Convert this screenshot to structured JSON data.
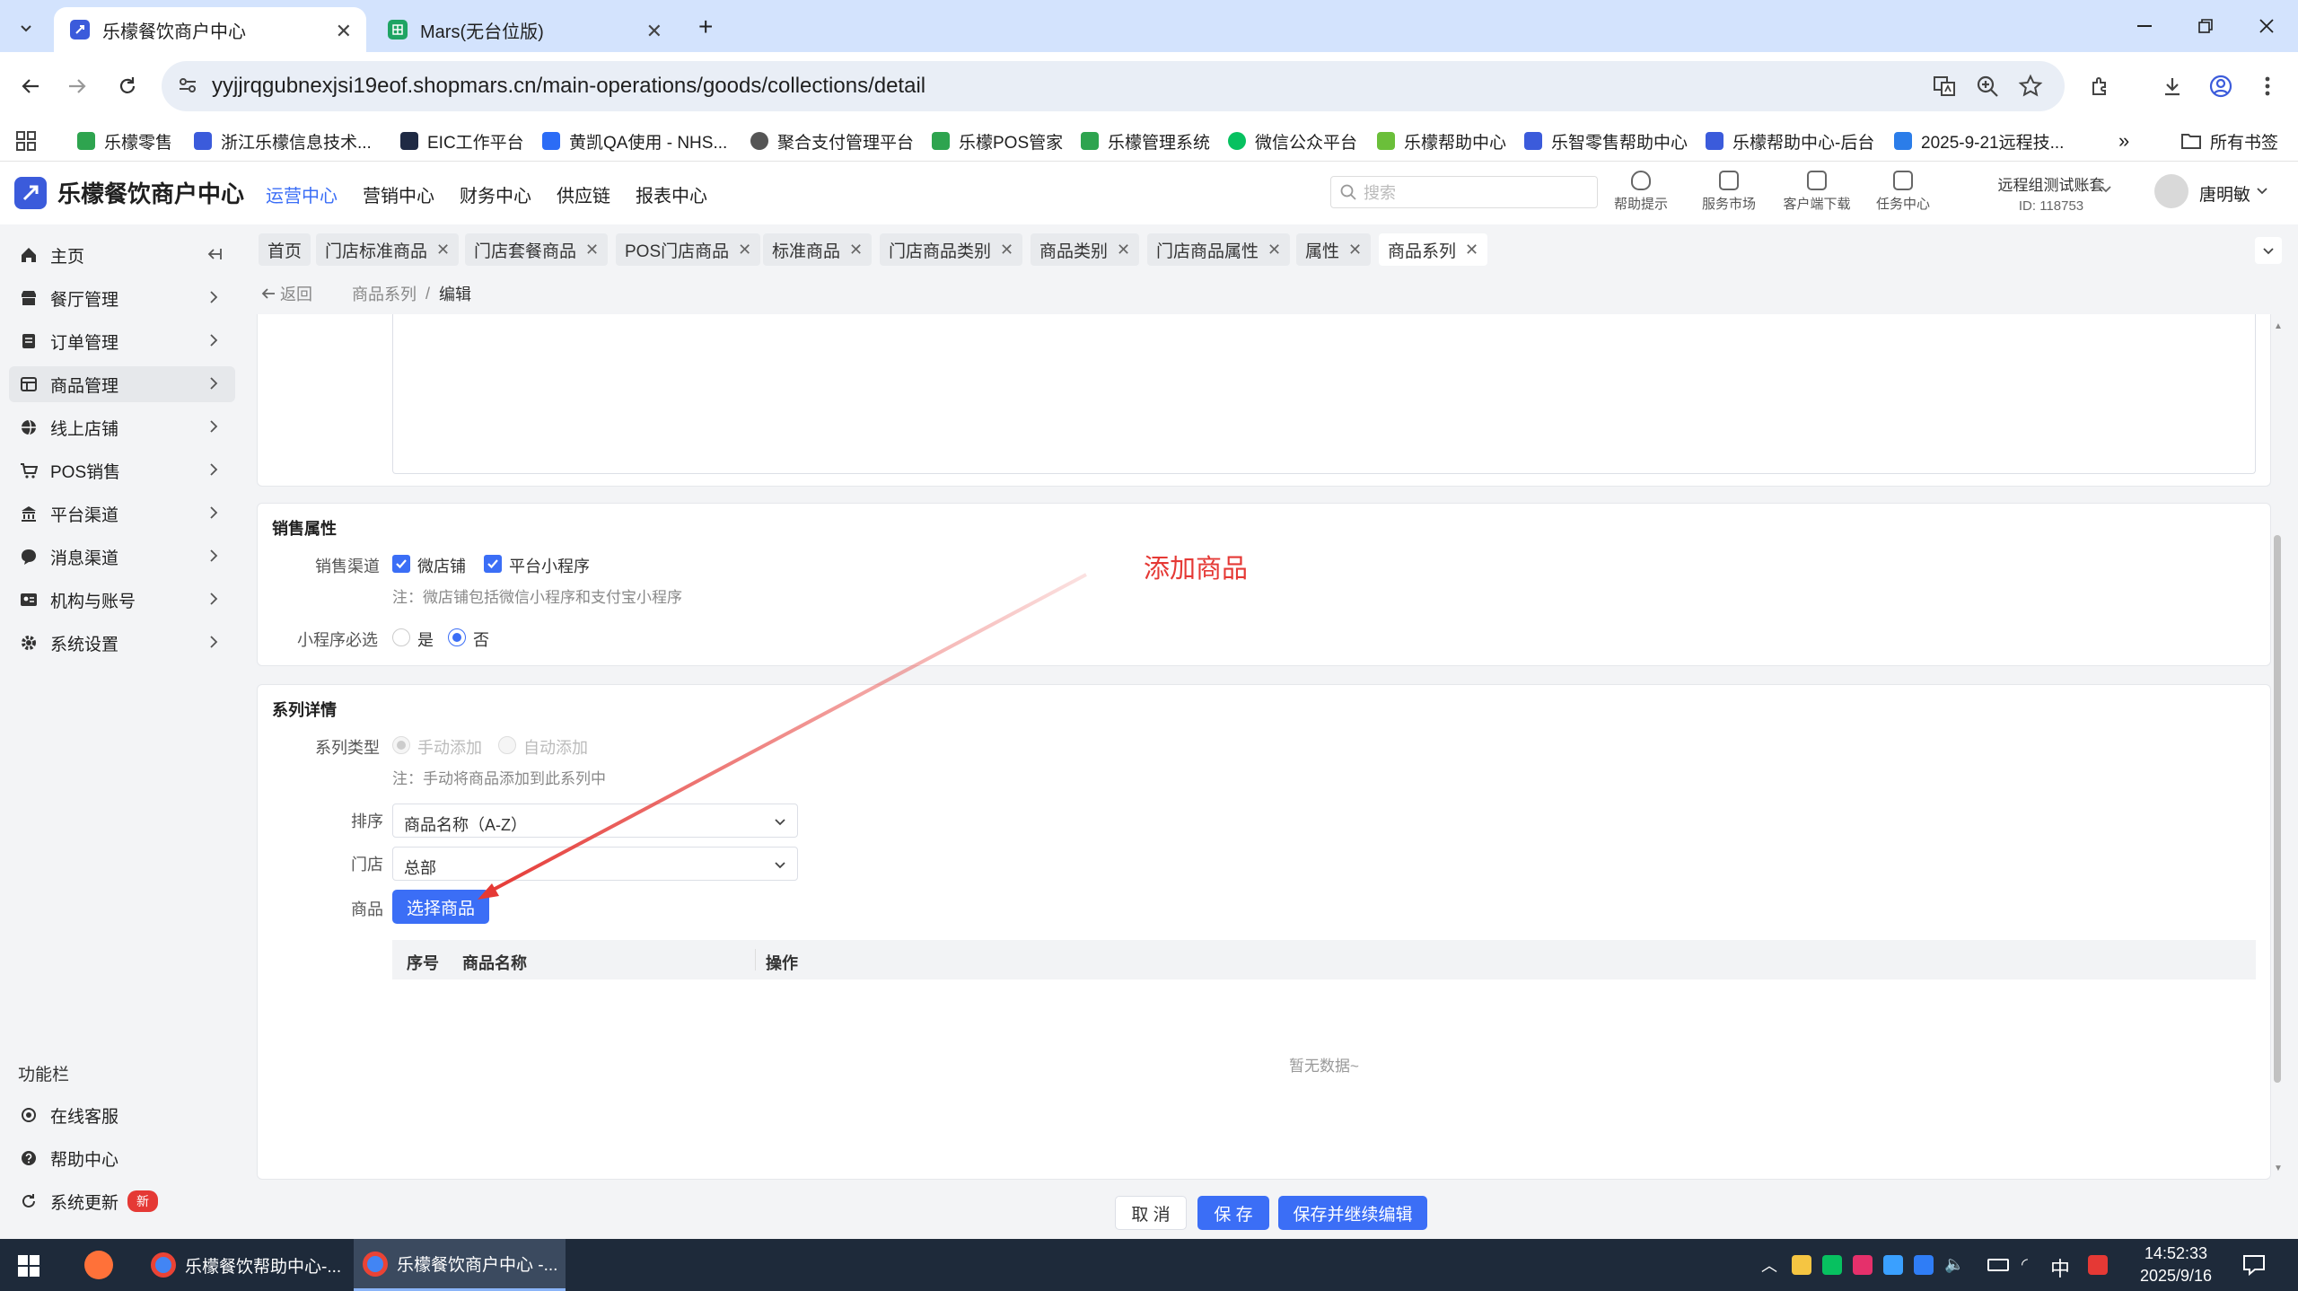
{
  "browser": {
    "tabs": [
      {
        "title": "乐檬餐饮商户中心",
        "active": true
      },
      {
        "title": "Mars(无台位版)",
        "active": false
      }
    ],
    "url": "yyjjrqgubnexjsi19eof.shopmars.cn/main-operations/goods/collections/detail",
    "bookmarks": [
      "乐檬零售",
      "浙江乐檬信息技术...",
      "EIC工作平台",
      "黄凯QA使用 - NHS...",
      "聚合支付管理平台",
      "乐檬POS管家",
      "乐檬管理系统",
      "微信公众平台",
      "乐檬帮助中心",
      "乐智零售帮助中心",
      "乐檬帮助中心-后台",
      "2025-9-21远程技..."
    ],
    "bookmarks_more": "»",
    "all_bookmarks": "所有书签"
  },
  "app": {
    "name": "乐檬餐饮商户中心",
    "topnav": [
      "运营中心",
      "营销中心",
      "财务中心",
      "供应链",
      "报表中心"
    ],
    "search_placeholder": "搜索",
    "header_icons": [
      "帮助提示",
      "服务市场",
      "客户端下载",
      "任务中心"
    ],
    "account": {
      "name": "远程组测试账套",
      "id": "ID: 118753"
    },
    "user": "唐明敏",
    "colors": {
      "primary": "#3b6ef6",
      "annotation": "#e53935"
    }
  },
  "sidebar": {
    "items": [
      "主页",
      "餐厅管理",
      "订单管理",
      "商品管理",
      "线上店铺",
      "POS销售",
      "平台渠道",
      "消息渠道",
      "机构与账号",
      "系统设置"
    ],
    "active": "商品管理",
    "section_title": "功能栏",
    "bottom": [
      "在线客服",
      "帮助中心",
      "系统更新"
    ],
    "badge_new": "新"
  },
  "tags": [
    "首页",
    "门店标准商品",
    "门店套餐商品",
    "POS门店商品",
    "标准商品",
    "门店商品类别",
    "商品类别",
    "门店商品属性",
    "属性",
    "商品系列"
  ],
  "breadcrumb": {
    "back": "返回",
    "path": "商品系列",
    "sep": "/",
    "current": "编辑"
  },
  "sales_props": {
    "title": "销售属性",
    "channel_label": "销售渠道",
    "channels": [
      {
        "label": "微店铺",
        "checked": true
      },
      {
        "label": "平台小程序",
        "checked": true
      }
    ],
    "note": "注：微店铺包括微信小程序和支付宝小程序",
    "required_label": "小程序必选",
    "required_options": [
      {
        "label": "是",
        "selected": false
      },
      {
        "label": "否",
        "selected": true
      }
    ]
  },
  "series": {
    "title": "系列详情",
    "type_label": "系列类型",
    "type_options": [
      {
        "label": "手动添加",
        "selected": true
      },
      {
        "label": "自动添加",
        "selected": false
      }
    ],
    "type_note": "注：手动将商品添加到此系列中",
    "sort_label": "排序",
    "sort_value": "商品名称（A-Z）",
    "store_label": "门店",
    "store_value": "总部",
    "goods_label": "商品",
    "select_button": "选择商品",
    "table_headers": [
      "序号",
      "商品名称",
      "操作"
    ],
    "empty_text": "暂无数据~"
  },
  "annotation": "添加商品",
  "footer": {
    "cancel": "取 消",
    "save": "保 存",
    "save_continue": "保存并继续编辑"
  },
  "taskbar": {
    "apps": [
      "乐檬餐饮帮助中心-...",
      "乐檬餐饮商户中心 -..."
    ],
    "ime": "中",
    "time": "14:52:33",
    "date": "2025/9/16"
  }
}
